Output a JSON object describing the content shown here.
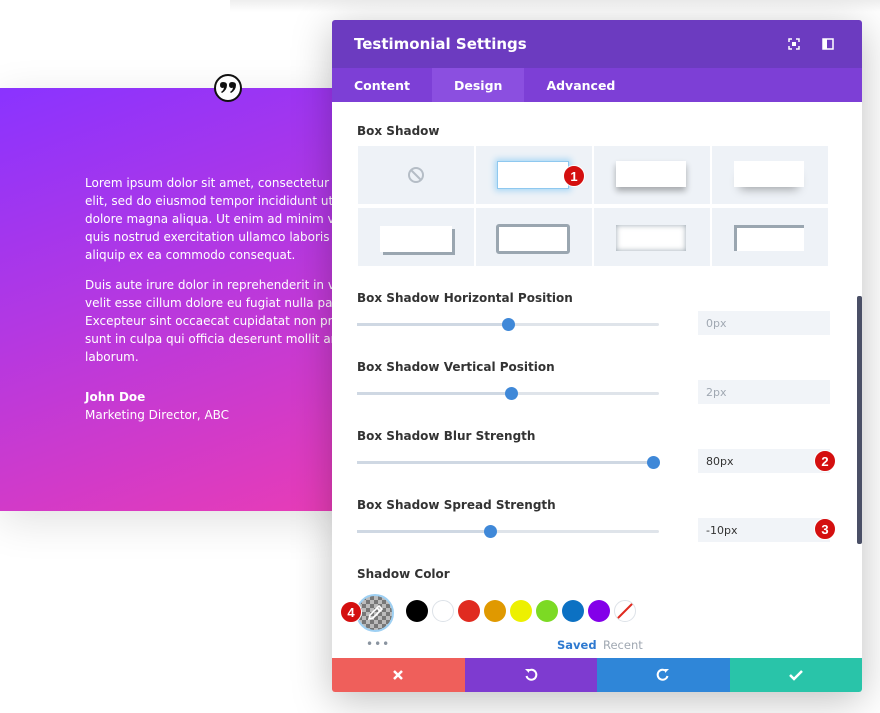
{
  "background": {
    "paragraph1": [
      "Lorem ipsum dolor sit amet, consectetur adi",
      "elit, sed do eiusmod tempor incididunt ut lab",
      "dolore magna aliqua. Ut enim ad minim veni",
      "quis nostrud exercitation ullamco laboris nis",
      "aliquip ex ea commodo consequat."
    ],
    "paragraph2": [
      "Duis aute irure dolor in reprehenderit in volu",
      "velit esse cillum dolore eu fugiat nulla pariat",
      "Excepteur sint occaecat cupidatat non proide",
      "sunt in culpa qui officia deserunt mollit anim",
      "laborum."
    ],
    "author_name": "John Doe",
    "author_role": "Marketing Director, ABC"
  },
  "modal": {
    "title": "Testimonial Settings",
    "tabs": [
      {
        "label": "Content"
      },
      {
        "label": "Design"
      },
      {
        "label": "Advanced"
      }
    ],
    "active_tab": "Design",
    "box_shadow_label": "Box Shadow",
    "fields": [
      {
        "label": "Box Shadow Horizontal Position",
        "value": "0px",
        "slider_fraction": 0.5
      },
      {
        "label": "Box Shadow Vertical Position",
        "value": "2px",
        "slider_fraction": 0.51
      },
      {
        "label": "Box Shadow Blur Strength",
        "value": "80px",
        "slider_fraction": 0.98
      },
      {
        "label": "Box Shadow Spread Strength",
        "value": "-10px",
        "slider_fraction": 0.44
      }
    ],
    "shadow_color_label": "Shadow Color",
    "swatch_colors": [
      "#000000",
      "#ffffff",
      "#e02b20",
      "#e09900",
      "#edf000",
      "#7cda24",
      "#0c71c3",
      "#8300e9"
    ],
    "more_dots": "•••",
    "saved_label": "Saved",
    "recent_label": "Recent",
    "badges": [
      "1",
      "2",
      "3",
      "4"
    ],
    "footer_colors": {
      "cancel": "#ef5f5b",
      "undo": "#7e3bd0",
      "redo": "#2f86d8",
      "save": "#29c4a9"
    }
  }
}
